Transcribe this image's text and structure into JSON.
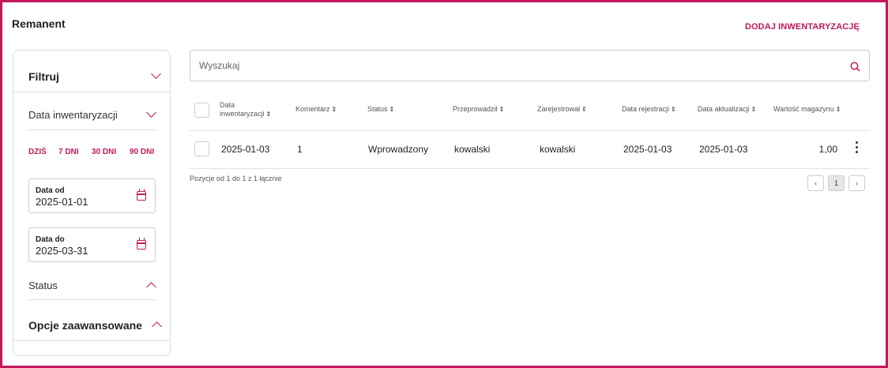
{
  "page": {
    "title": "Remanent",
    "add_button": "DODAJ INWENTARYZACJĘ"
  },
  "filters": {
    "title": "Filtruj",
    "date_section": "Data inwentaryzacji",
    "quick_ranges": [
      "DZIŚ",
      "7 DNI",
      "30 DNI",
      "90 DNI"
    ],
    "date_from": {
      "label": "Data od",
      "value": "2025-01-01"
    },
    "date_to": {
      "label": "Data do",
      "value": "2025-03-31"
    },
    "status_section": "Status",
    "advanced_section": "Opcje zaawansowane"
  },
  "search": {
    "placeholder": "Wyszukaj"
  },
  "table": {
    "headers": {
      "date_line1": "Data",
      "date_line2": "inwentaryzacji",
      "comment": "Komentarz",
      "status": "Status",
      "performed_by": "Przeprowadził",
      "registered_by": "Zarejestrował",
      "reg_date": "Data rejestracji",
      "upd_date": "Data aktualizacji",
      "value": "Wartość magazynu"
    },
    "rows": [
      {
        "date": "2025-01-03",
        "comment": "1",
        "status": "Wprowadzony",
        "performed_by": "kowalski",
        "registered_by": "kowalski",
        "reg_date": "2025-01-03",
        "upd_date": "2025-01-03",
        "value": "1,00"
      }
    ],
    "summary": "Pozycje od 1 do 1 z 1 łącznie",
    "pagination": {
      "prev": "‹",
      "page": "1",
      "next": "›"
    }
  },
  "colors": {
    "accent": "#c2185b",
    "border": "#dddddd"
  }
}
